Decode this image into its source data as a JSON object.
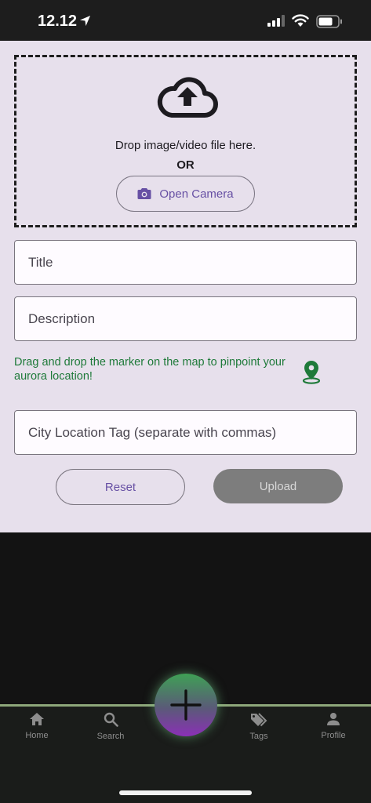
{
  "status_bar": {
    "time": "12.12",
    "location_icon": "location-arrow-icon",
    "signal_icon": "cellular-signal-icon",
    "wifi_icon": "wifi-icon",
    "battery_icon": "battery-icon"
  },
  "upload": {
    "cloud_icon": "cloud-upload-icon",
    "drop_text": "Drop image/video file here.",
    "or_text": "OR",
    "camera_icon": "camera-icon",
    "camera_label": "Open Camera"
  },
  "form": {
    "title_placeholder": "Title",
    "description_placeholder": "Description",
    "map_hint": "Drag and drop the marker on the map to pinpoint your aurora location!",
    "pin_icon": "map-pin-icon",
    "city_placeholder": "City Location Tag (separate with commas)",
    "reset_label": "Reset",
    "upload_label": "Upload"
  },
  "nav": {
    "items": [
      {
        "label": "Home",
        "icon": "home-icon"
      },
      {
        "label": "Search",
        "icon": "search-icon"
      },
      {
        "label": "Tags",
        "icon": "tags-icon"
      },
      {
        "label": "Profile",
        "icon": "profile-icon"
      }
    ],
    "fab_icon": "plus-icon"
  },
  "colors": {
    "form_background": "#e7e0ec",
    "accent": "#6750a4",
    "hint_green": "#1f7a3a",
    "nav_line": "#8ea77a",
    "upload_disabled": "#7d7d7d"
  }
}
